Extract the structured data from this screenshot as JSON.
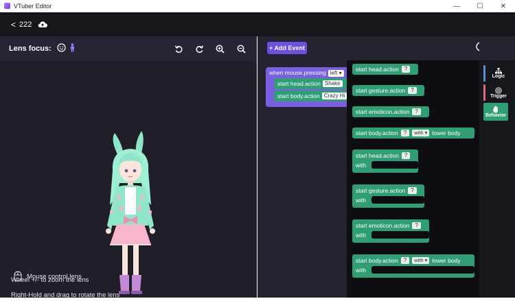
{
  "window": {
    "title": "VTuber Editor",
    "minimize": "—",
    "maximize": "☐",
    "close": "✕"
  },
  "header": {
    "back_glyph": "<",
    "project_name": "222",
    "cloud_icon": "cloud-upload-icon"
  },
  "lens": {
    "label": "Lens focus:",
    "face_icon": "face-icon",
    "body_icon": "person-icon"
  },
  "toolbar_icons": [
    "undo-icon",
    "redo-icon",
    "zoom-in-icon",
    "zoom-out-icon"
  ],
  "hints": {
    "mouse_control": "Mouse control lens",
    "rotate": "Right-Hold and drag to rotate the lens",
    "zoom": "Wheel +/- to zoom the lens"
  },
  "workspace": {
    "add_event_label": "+ Add Event",
    "event": {
      "when_text": "when mouse.pressing",
      "button_value": "left",
      "actions": [
        {
          "text": "start head.action",
          "value": "Shake"
        },
        {
          "text": "start body.action",
          "value": "Crazy Hi"
        }
      ],
      "overlay_text": "lower body"
    }
  },
  "flyout": {
    "blocks": [
      {
        "text": "start head.action",
        "q": "?",
        "with_label": ""
      },
      {
        "text": "start gesture.action",
        "q": "?",
        "with_label": ""
      },
      {
        "text": "start emoticon.action",
        "q": "?",
        "with_label": ""
      },
      {
        "text": "start body.action",
        "q": "?",
        "with_chip": "with",
        "tail": "lower body"
      },
      {
        "text": "start head.action",
        "q": "?",
        "with_label": "with"
      },
      {
        "text": "start gesture.action",
        "q": "?",
        "with_label": "with"
      },
      {
        "text": "start emoticon.action",
        "q": "?",
        "with_label": "with"
      },
      {
        "text": "start body.action",
        "q": "?",
        "with_chip": "with",
        "tail": "lower body",
        "with_label": "with"
      }
    ]
  },
  "categories": [
    {
      "label": "Logic",
      "color": "#5b8fd6"
    },
    {
      "label": "Trigger",
      "color": "#e06b7a"
    },
    {
      "label": "Behavior",
      "color": "#2f9e75"
    }
  ],
  "colors": {
    "accent": "#6b4fe0",
    "event_block": "#7c5ee0",
    "behavior_block": "#2f9e75",
    "background": "#1f1e29"
  }
}
